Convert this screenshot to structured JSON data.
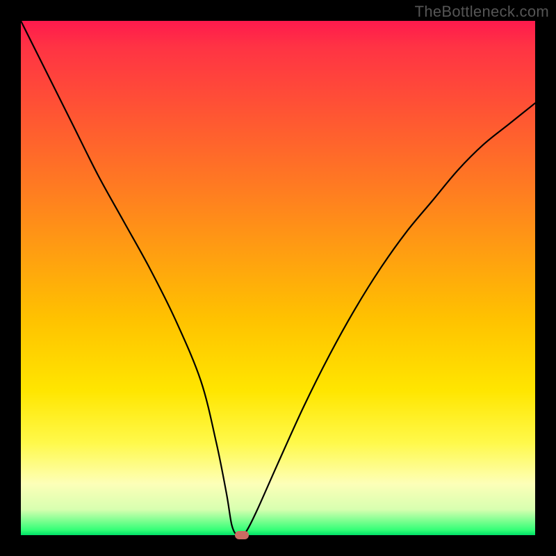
{
  "watermark": "TheBottleneck.com",
  "chart_data": {
    "type": "line",
    "title": "",
    "xlabel": "",
    "ylabel": "",
    "xlim": [
      0,
      100
    ],
    "ylim": [
      0,
      100
    ],
    "series": [
      {
        "name": "bottleneck-curve",
        "x": [
          0,
          5,
          10,
          15,
          20,
          25,
          30,
          35,
          38,
          40,
          41,
          42,
          43,
          44,
          46,
          50,
          55,
          60,
          65,
          70,
          75,
          80,
          85,
          90,
          95,
          100
        ],
        "values": [
          100,
          90,
          80,
          70,
          61,
          52,
          42,
          30,
          18,
          8,
          2,
          0,
          0,
          1,
          5,
          14,
          25,
          35,
          44,
          52,
          59,
          65,
          71,
          76,
          80,
          84
        ]
      }
    ],
    "marker": {
      "x": 43,
      "y": 0,
      "color": "#cc6b63"
    },
    "background_gradient": {
      "type": "vertical",
      "stops": [
        {
          "pos": 0.0,
          "color": "#ff1a4d"
        },
        {
          "pos": 0.18,
          "color": "#ff5533"
        },
        {
          "pos": 0.45,
          "color": "#ff9e11"
        },
        {
          "pos": 0.72,
          "color": "#ffe600"
        },
        {
          "pos": 0.9,
          "color": "#fdffb8"
        },
        {
          "pos": 0.99,
          "color": "#33ff77"
        },
        {
          "pos": 1.0,
          "color": "#00e066"
        }
      ]
    }
  }
}
